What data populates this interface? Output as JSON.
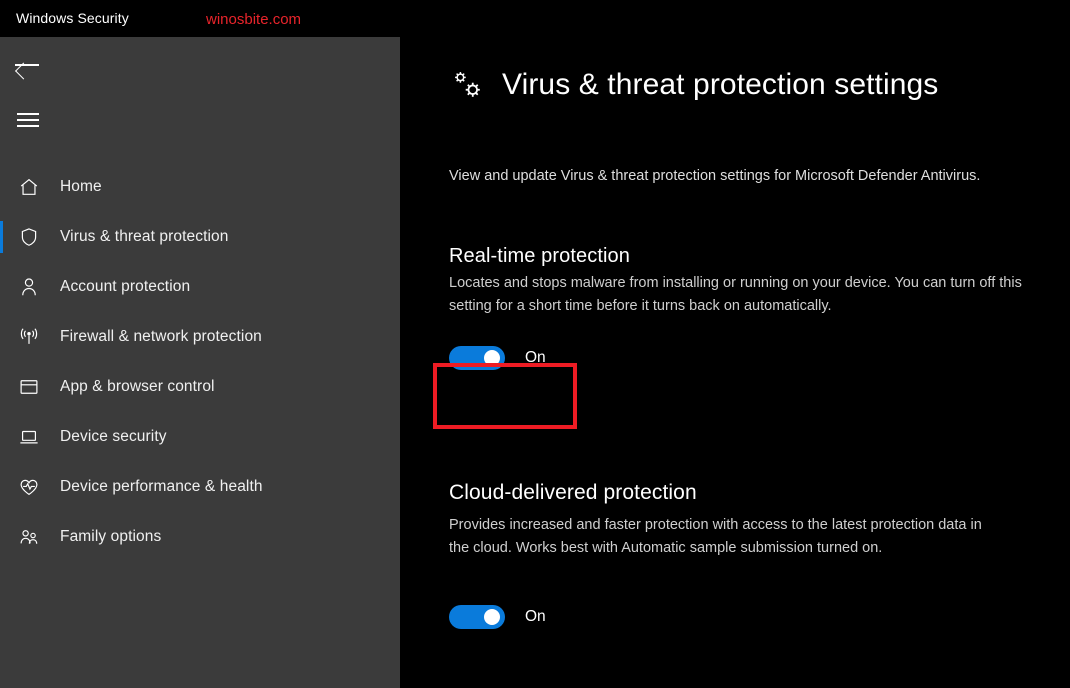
{
  "titlebar": {
    "app_title": "Windows Security",
    "watermark": "winosbite.com"
  },
  "sidebar": {
    "back_icon": "back-arrow-icon",
    "menu_icon": "hamburger-menu-icon",
    "items": [
      {
        "label": "Home",
        "icon": "home-icon",
        "active": false
      },
      {
        "label": "Virus & threat protection",
        "icon": "shield-icon",
        "active": true
      },
      {
        "label": "Account protection",
        "icon": "person-icon",
        "active": false
      },
      {
        "label": "Firewall & network protection",
        "icon": "wifi-signal-icon",
        "active": false
      },
      {
        "label": "App & browser control",
        "icon": "window-icon",
        "active": false
      },
      {
        "label": "Device security",
        "icon": "laptop-icon",
        "active": false
      },
      {
        "label": "Device performance & health",
        "icon": "heart-pulse-icon",
        "active": false
      },
      {
        "label": "Family options",
        "icon": "family-people-icon",
        "active": false
      }
    ]
  },
  "main": {
    "header_icon": "gears-icon",
    "title": "Virus & threat protection settings",
    "subtitle": "View and update Virus & threat protection settings for Microsoft Defender Antivirus.",
    "sections": [
      {
        "title": "Real-time protection",
        "description": "Locates and stops malware from installing or running on your device. You can turn off this setting for a short time before it turns back on automatically.",
        "toggle_state": "On"
      },
      {
        "title": "Cloud-delivered protection",
        "description": "Provides increased and faster protection with access to the latest protection data in the cloud. Works best with Automatic sample submission turned on.",
        "toggle_state": "On"
      }
    ]
  },
  "colors": {
    "accent_blue": "#0a7bdb",
    "annotation_red": "#ee1c24",
    "sidebar_bg": "#3b3b3b",
    "content_bg": "#000000",
    "watermark_red": "#e8242b"
  }
}
